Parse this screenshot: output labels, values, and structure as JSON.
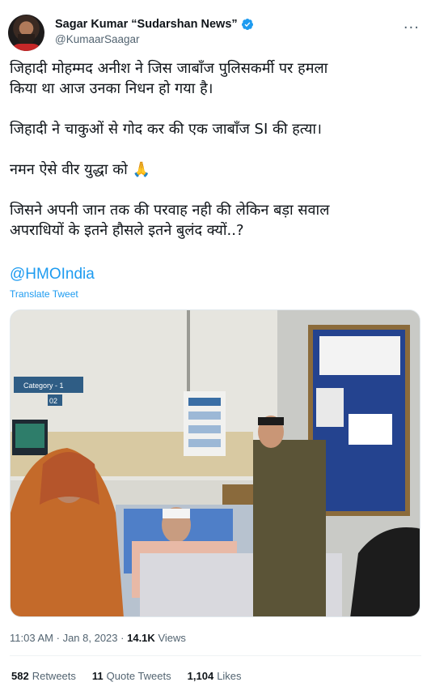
{
  "author": {
    "display_name": "Sagar Kumar “Sudarshan News”",
    "handle": "@KumaarSaagar",
    "verified": true
  },
  "tweet": {
    "paragraphs": [
      "जिहादी मोहम्मद अनीश ने जिस जाबाँज पुलिसकर्मी पर हमला\nकिया था आज उनका निधन हो गया है।",
      "जिहादी ने चाकुओं से गोद कर की एक जाबाँज SI की हत्या।",
      "नमन ऐसे वीर युद्धा को 🙏",
      "जिसने अपनी जान तक की परवाह नही की लेकिन बड़ा सवाल\nअपराधियों के इतने हौसले इतने बुलंद क्यों..?"
    ],
    "mention": "@HMOIndia",
    "translate_label": "Translate Tweet"
  },
  "photo": {
    "sign_text": "Category - 1",
    "sign_number": "02"
  },
  "meta": {
    "time": "11:03 AM",
    "separator": "·",
    "date": "Jan 8, 2023",
    "views_count": "14.1K",
    "views_label": "Views"
  },
  "stats": {
    "retweets_count": "582",
    "retweets_label": "Retweets",
    "quotes_count": "11",
    "quotes_label": "Quote Tweets",
    "likes_count": "1,104",
    "likes_label": "Likes"
  },
  "colors": {
    "link": "#1d9bf0",
    "secondary_text": "#536471",
    "verified": "#1d9bf0"
  },
  "icons": [
    "verified-badge-icon",
    "more-options-icon",
    "folded-hands-emoji"
  ]
}
